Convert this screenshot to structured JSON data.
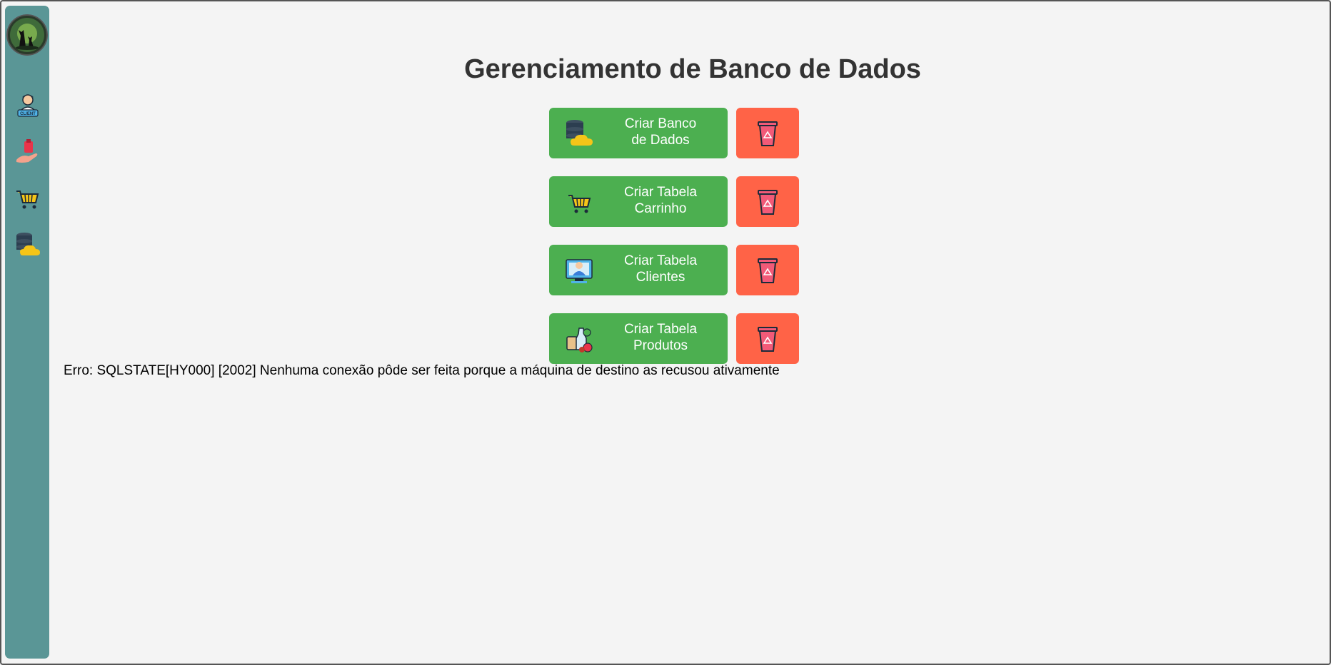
{
  "page": {
    "title": "Gerenciamento de Banco de Dados",
    "error": "Erro: SQLSTATE[HY000] [2002] Nenhuma conexão pôde ser feita porque a máquina de destino as recusou ativamente"
  },
  "sidebar": {
    "items": [
      {
        "name": "client-icon",
        "text": "CLIENT"
      },
      {
        "name": "product-hand-icon"
      },
      {
        "name": "cart-icon"
      },
      {
        "name": "database-cloud-icon"
      }
    ]
  },
  "rows": [
    {
      "label_line1": "Criar Banco",
      "label_line2": "de Dados",
      "icon": "database-cloud-icon"
    },
    {
      "label_line1": "Criar Tabela",
      "label_line2": "Carrinho",
      "icon": "cart-icon"
    },
    {
      "label_line1": "Criar Tabela",
      "label_line2": "Clientes",
      "icon": "client-computer-icon"
    },
    {
      "label_line1": "Criar Tabela",
      "label_line2": "Produtos",
      "icon": "products-icon"
    }
  ],
  "colors": {
    "sidebar": "#5a9696",
    "create": "#4caf50",
    "delete": "#ff6347"
  }
}
